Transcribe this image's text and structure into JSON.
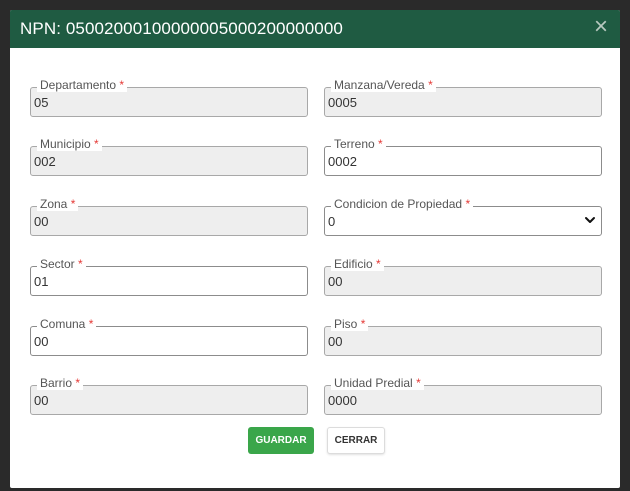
{
  "modal": {
    "title": "NPN: 05002000100000005000200000000",
    "close_glyph": "×",
    "save_label": "GUARDAR",
    "close_label": "CERRAR"
  },
  "required_marker": "*",
  "fields": {
    "departamento": {
      "label": "Departamento",
      "value": "05"
    },
    "manzana_vereda": {
      "label": "Manzana/Vereda",
      "value": "0005"
    },
    "municipio": {
      "label": "Municipio",
      "value": "002"
    },
    "terreno": {
      "label": "Terreno",
      "value": "0002"
    },
    "zona": {
      "label": "Zona",
      "value": "00"
    },
    "condicion_propiedad": {
      "label": "Condicion de Propiedad",
      "value": "0"
    },
    "sector": {
      "label": "Sector",
      "value": "01"
    },
    "edificio": {
      "label": "Edificio",
      "value": "00"
    },
    "comuna": {
      "label": "Comuna",
      "value": "00"
    },
    "piso": {
      "label": "Piso",
      "value": "00"
    },
    "barrio": {
      "label": "Barrio",
      "value": "00"
    },
    "unidad_predial": {
      "label": "Unidad Predial",
      "value": "0000"
    }
  },
  "colors": {
    "header": "#1f5b42",
    "save_button": "#3aa64a",
    "required": "#e53935"
  }
}
